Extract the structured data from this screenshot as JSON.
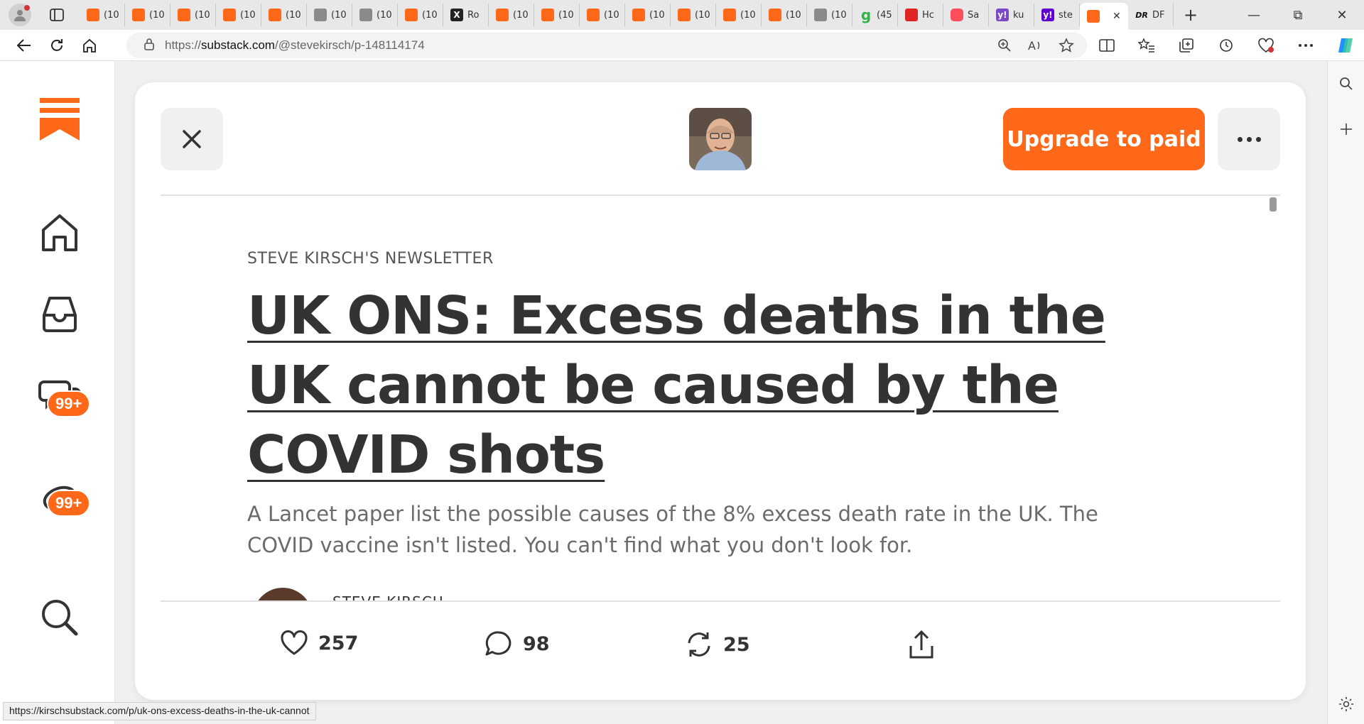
{
  "browser": {
    "tabs": [
      {
        "label": "(10",
        "favicon": "substack"
      },
      {
        "label": "(10",
        "favicon": "substack"
      },
      {
        "label": "(10",
        "favicon": "substack"
      },
      {
        "label": "(10",
        "favicon": "substack"
      },
      {
        "label": "(10",
        "favicon": "substack"
      },
      {
        "label": "(10",
        "favicon": "grey"
      },
      {
        "label": "(10",
        "favicon": "grey"
      },
      {
        "label": "(10",
        "favicon": "substack"
      },
      {
        "label": "Ro",
        "favicon": "x"
      },
      {
        "label": "(10",
        "favicon": "substack"
      },
      {
        "label": "(10",
        "favicon": "substack"
      },
      {
        "label": "(10",
        "favicon": "substack"
      },
      {
        "label": "(10",
        "favicon": "substack"
      },
      {
        "label": "(10",
        "favicon": "substack"
      },
      {
        "label": "(10",
        "favicon": "substack"
      },
      {
        "label": "(10",
        "favicon": "substack"
      },
      {
        "label": "(10",
        "favicon": "grey"
      },
      {
        "label": "(45",
        "favicon": "g"
      },
      {
        "label": "Hc",
        "favicon": "red"
      },
      {
        "label": "Sa",
        "favicon": "yt"
      },
      {
        "label": "ku",
        "favicon": "yh"
      },
      {
        "label": "ste",
        "favicon": "yh2"
      }
    ],
    "active_tab": {
      "label": "",
      "favicon": "substack"
    },
    "last_tab": {
      "label": "DF",
      "favicon": "dr"
    },
    "url_prefix": "https://",
    "url_domain": "substack.com",
    "url_path": "/@stevekirsch/p-148114174",
    "status_url": "https://kirschsubstack.com/p/uk-ons-excess-deaths-in-the-uk-cannot"
  },
  "sidebar": {
    "chat_badge": "99+",
    "activity_badge": "99+"
  },
  "post": {
    "upgrade_label": "Upgrade to paid",
    "publication": "STEVE KIRSCH'S NEWSLETTER",
    "title": "UK ONS: Excess deaths in the UK cannot be caused by the COVID shots",
    "subtitle": "A Lancet paper list the possible causes of the 8% excess death rate in the UK. The COVID vaccine isn't listed. You can't find what you don't look for.",
    "author": "STEVE KIRSCH",
    "likes": "257",
    "comments": "98",
    "restacks": "25"
  },
  "colors": {
    "accent": "#ff6719",
    "text": "#333333"
  }
}
